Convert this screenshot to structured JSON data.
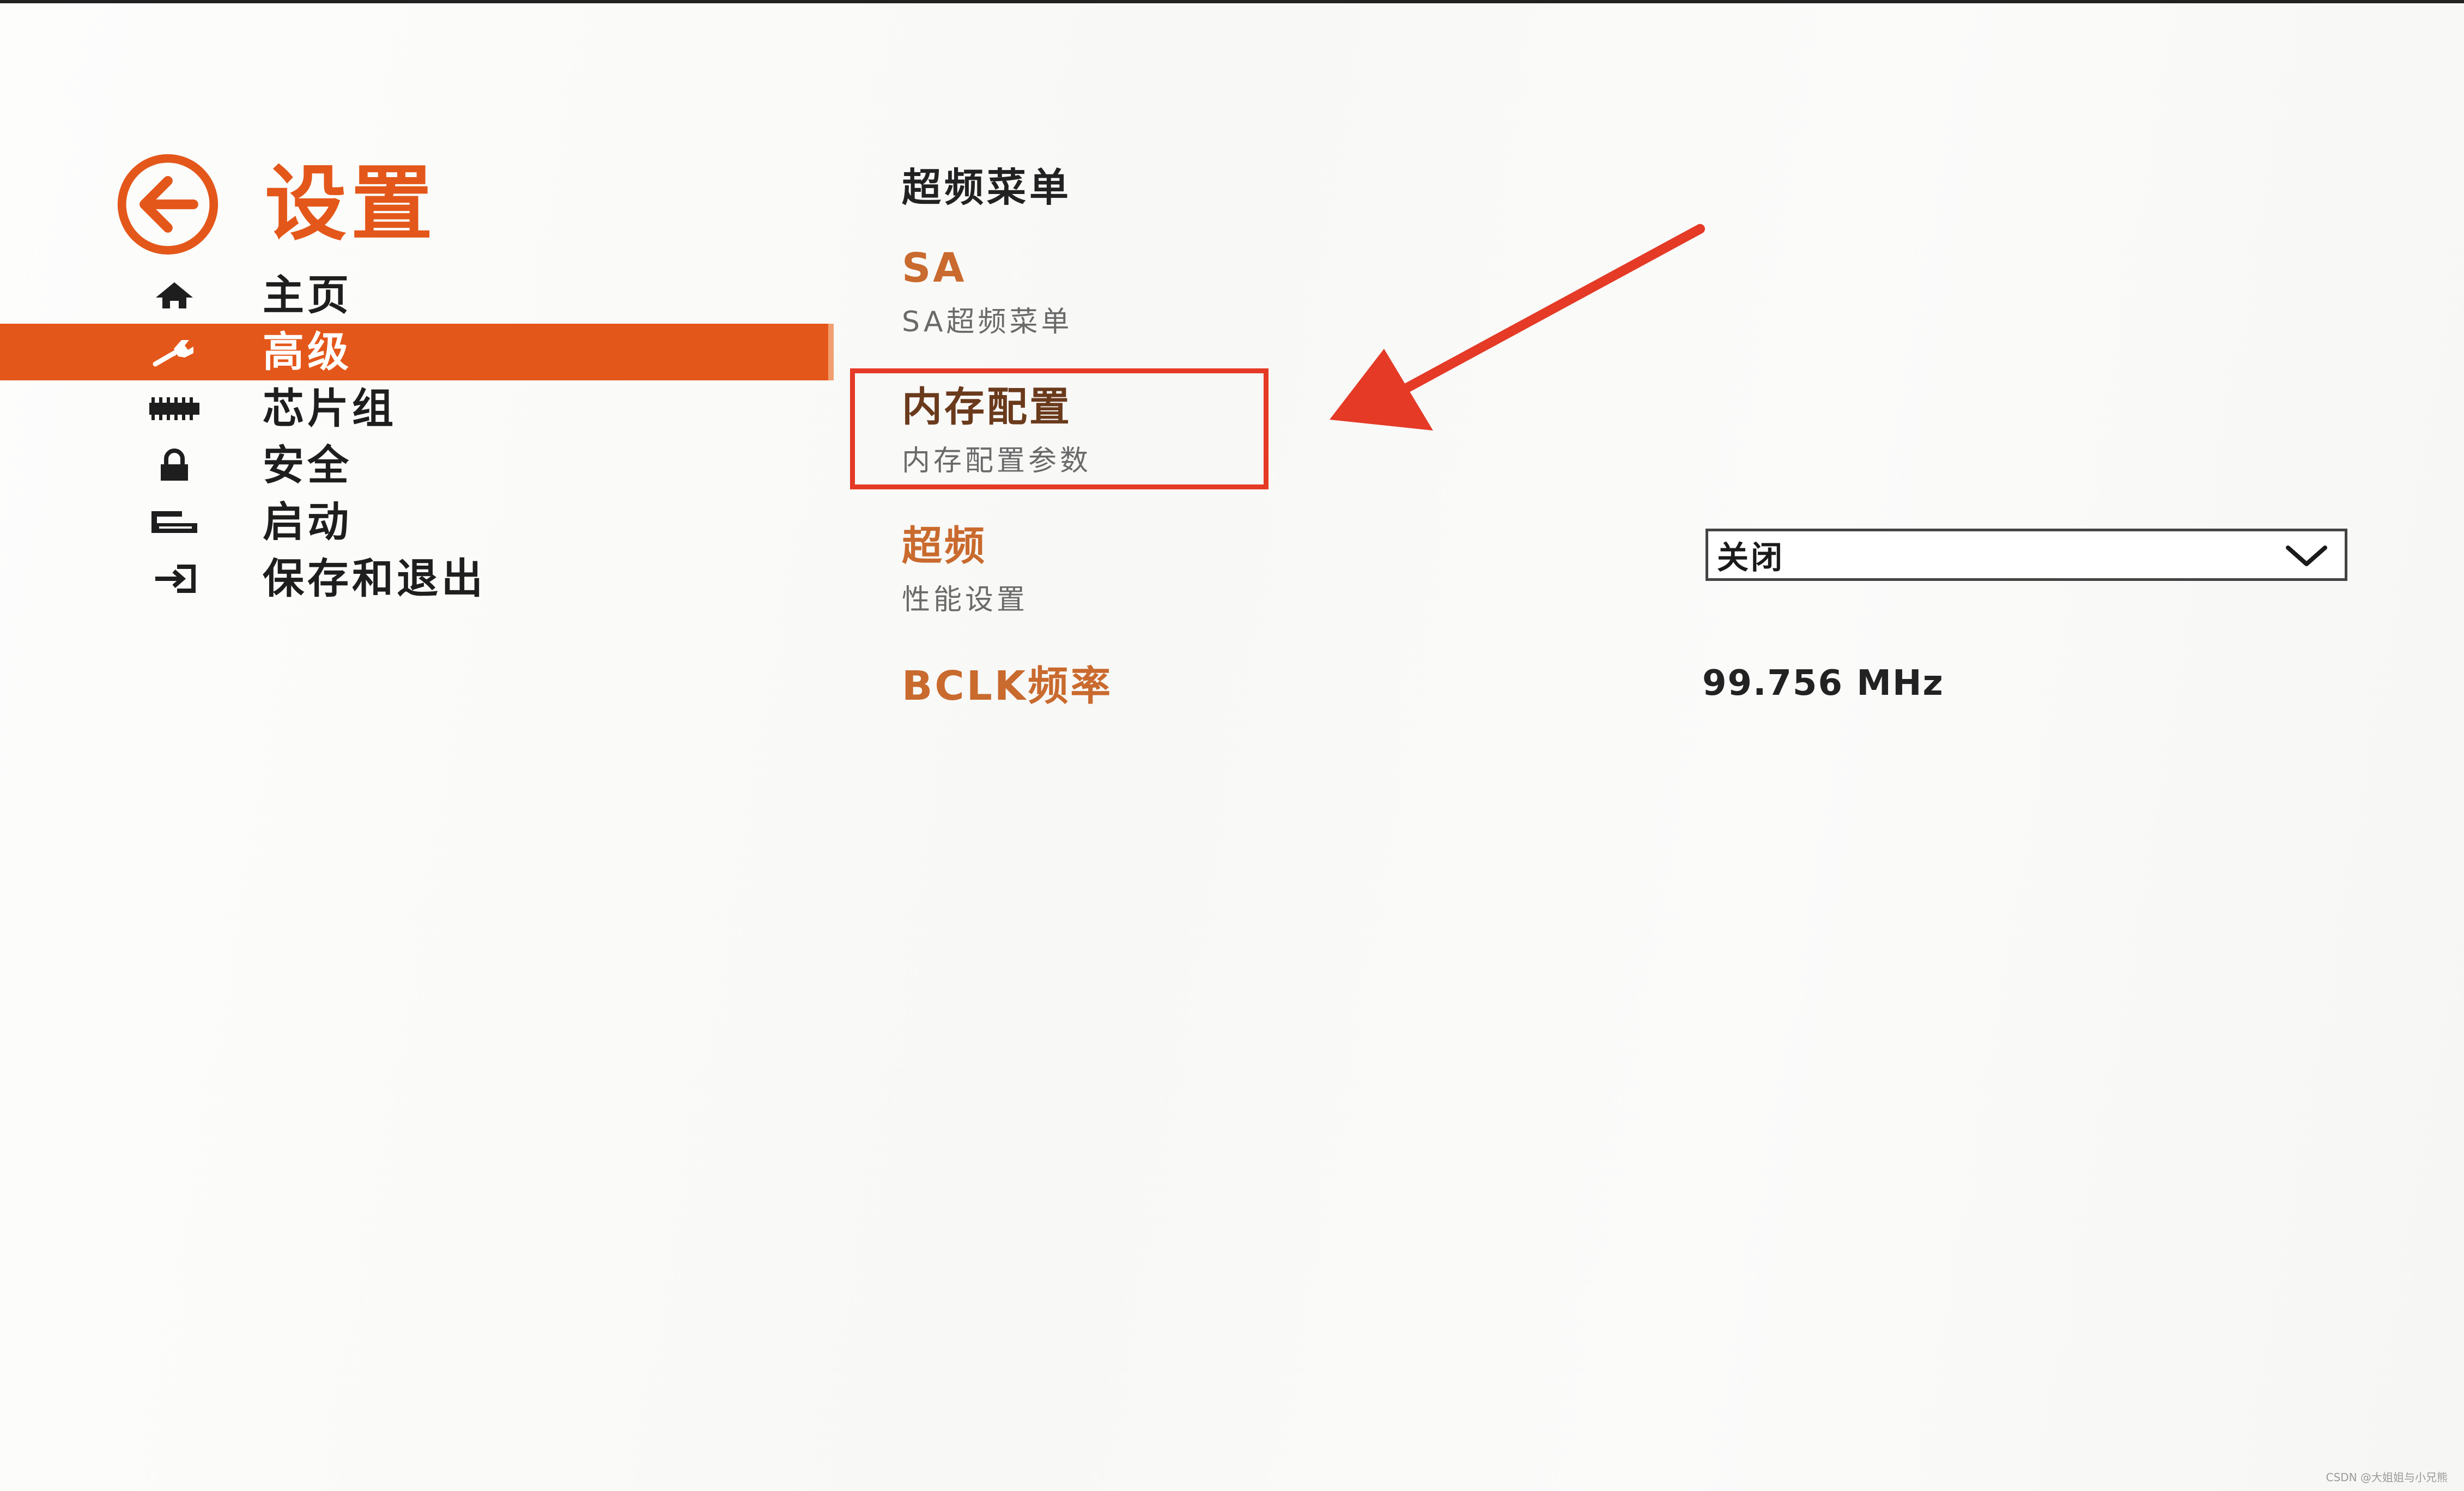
{
  "header": {
    "title": "设置",
    "back_icon": "back-arrow-circle-icon"
  },
  "nav": {
    "items": [
      {
        "label": "主页",
        "icon": "home-icon",
        "active": false
      },
      {
        "label": "高级",
        "icon": "wrench-icon",
        "active": true
      },
      {
        "label": "芯片组",
        "icon": "chip-icon",
        "active": false
      },
      {
        "label": "安全",
        "icon": "lock-icon",
        "active": false
      },
      {
        "label": "启动",
        "icon": "boot-drive-icon",
        "active": false
      },
      {
        "label": "保存和退出",
        "icon": "exit-icon",
        "active": false
      }
    ]
  },
  "main": {
    "section_title": "超频菜单",
    "entries": [
      {
        "title": "SA",
        "subtitle": "SA超频菜单"
      },
      {
        "title": "内存配置",
        "subtitle": "内存配置参数"
      },
      {
        "title": "超频",
        "subtitle": "性能设置"
      },
      {
        "title": "BCLK频率"
      }
    ],
    "overclock_dropdown": {
      "selected": "关闭"
    },
    "bclk_value": "99.756 MHz"
  },
  "annotation": {
    "highlight_color": "#e43a26"
  },
  "colors": {
    "accent": "#e4571a",
    "entry_title": "#c96a2e"
  },
  "watermark": "CSDN @大姐姐与小兄熊"
}
